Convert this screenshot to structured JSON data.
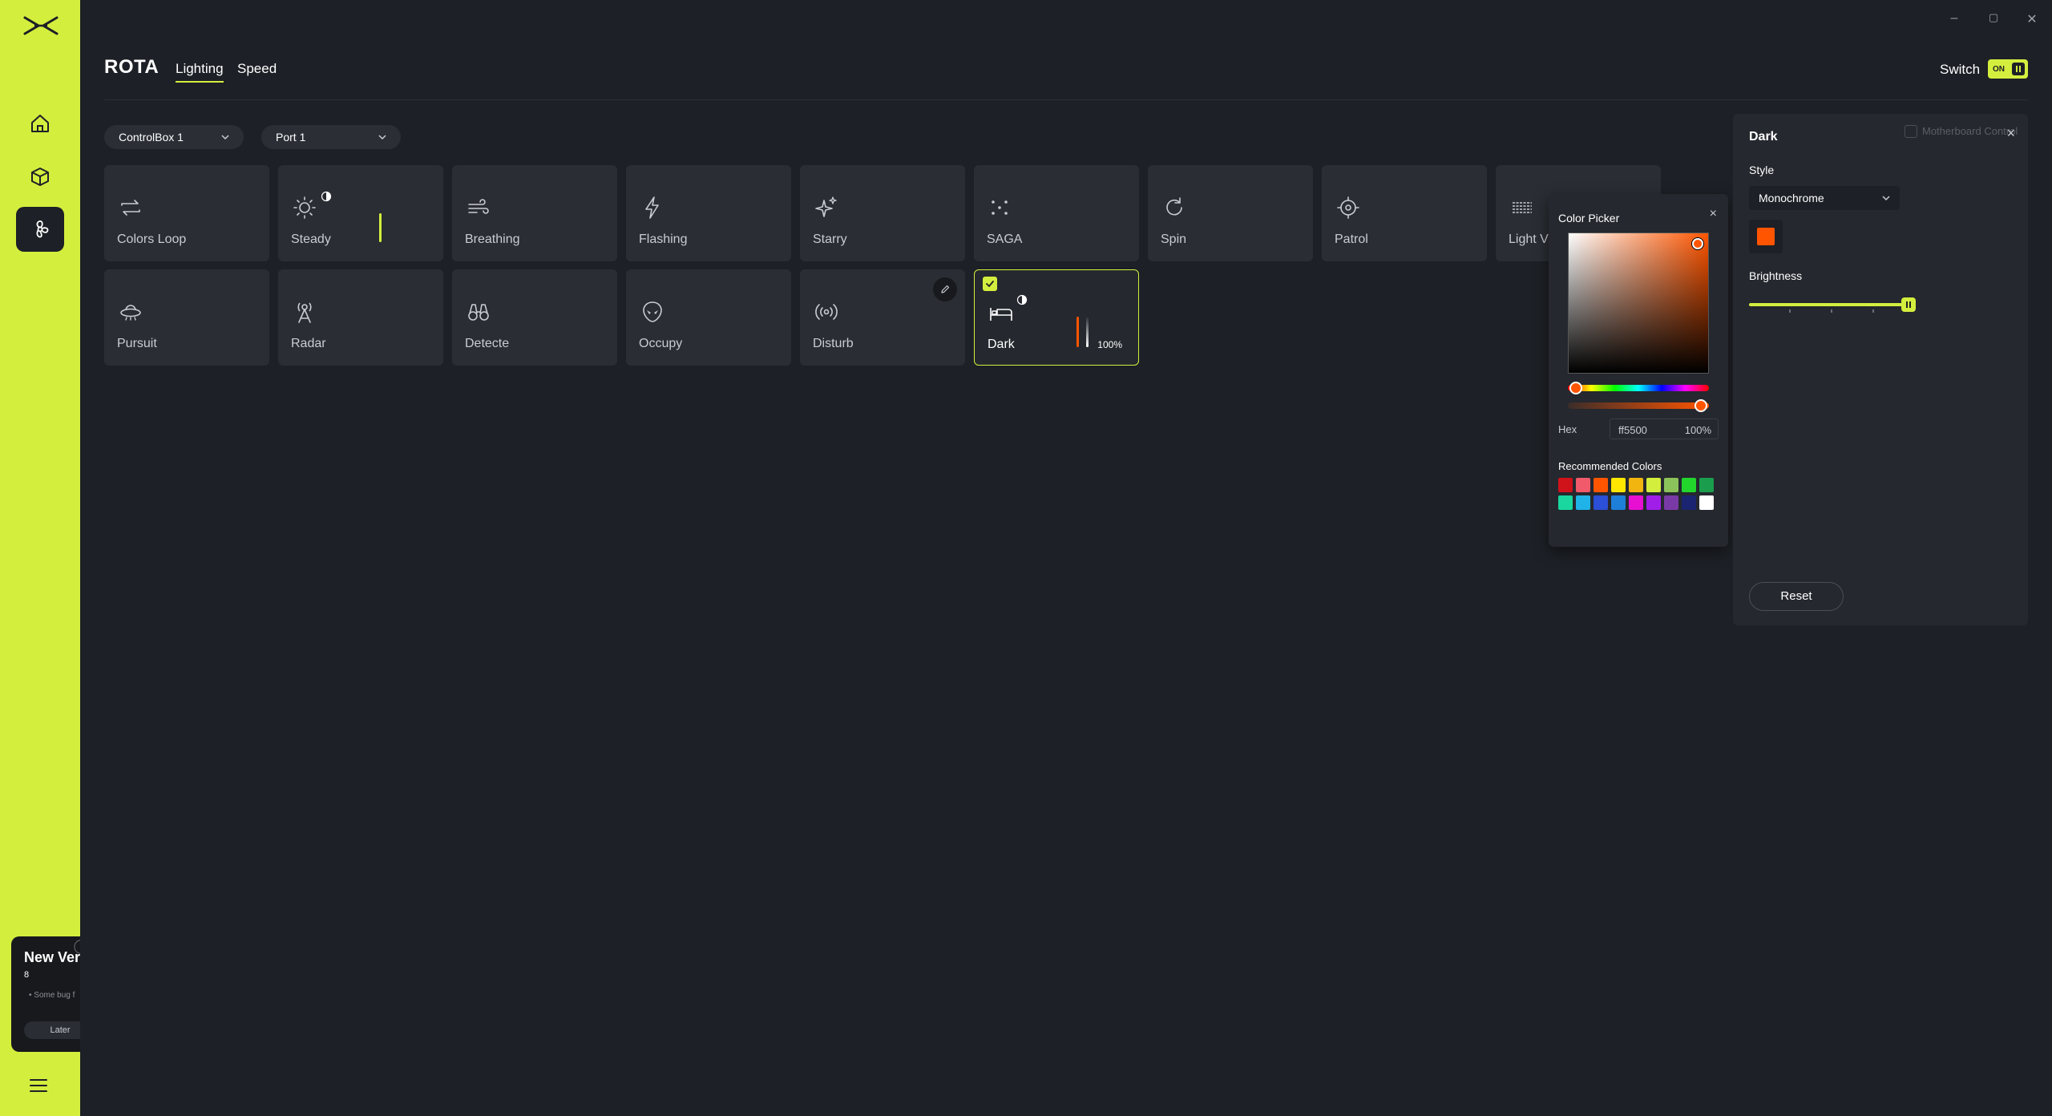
{
  "window": {
    "minimize_glyph": "–",
    "maximize_glyph": "▢",
    "close_glyph": "✕"
  },
  "sidebar": {
    "items": [
      {
        "name": "home",
        "icon": "home-icon",
        "active": false
      },
      {
        "name": "devices",
        "icon": "box-icon",
        "active": false
      },
      {
        "name": "fan",
        "icon": "fan-icon",
        "active": true
      }
    ],
    "update_card": {
      "title": "New Ver",
      "version": "8",
      "note": "• Some bug f",
      "later_label": "Later"
    }
  },
  "header": {
    "brand": "ROTA",
    "tabs": [
      {
        "label": "Lighting",
        "active": true
      },
      {
        "label": "Speed",
        "active": false
      }
    ],
    "switch_label": "Switch",
    "switch_state": "ON"
  },
  "selectors": {
    "controlbox": "ControlBox 1",
    "port": "Port 1"
  },
  "effects": [
    {
      "label": "Colors Loop",
      "icon": "loop-icon"
    },
    {
      "label": "Steady",
      "icon": "sun-icon"
    },
    {
      "label": "Breathing",
      "icon": "wind-icon"
    },
    {
      "label": "Flashing",
      "icon": "lightning-icon"
    },
    {
      "label": "Starry",
      "icon": "sparkle-icon"
    },
    {
      "label": "SAGA",
      "icon": "dots-icon"
    },
    {
      "label": "Spin",
      "icon": "rotate-icon"
    },
    {
      "label": "Patrol",
      "icon": "target-icon"
    },
    {
      "label": "Light V",
      "icon": "wave-lines-icon"
    },
    {
      "label": "Pursuit",
      "icon": "ufo-icon"
    },
    {
      "label": "Radar",
      "icon": "radar-icon"
    },
    {
      "label": "Detecte",
      "icon": "binoculars-icon"
    },
    {
      "label": "Occupy",
      "icon": "alien-icon"
    },
    {
      "label": "Disturb",
      "icon": "broadcast-icon"
    },
    {
      "label": "Dark",
      "icon": "bed-icon",
      "selected": true,
      "brightness": "100%"
    }
  ],
  "color_picker": {
    "title": "Color Picker",
    "close_glyph": "×",
    "hex_label": "Hex",
    "hex_value": "ff5500",
    "alpha_value": "100%",
    "recommended_title": "Recommended Colors",
    "swatches": [
      "#d0121b",
      "#f05a6a",
      "#ff5500",
      "#ffe600",
      "#f2b50f",
      "#d4ee3e",
      "#8cc25a",
      "#22d62c",
      "#1a9d4d",
      "#19d79f",
      "#1fb3e8",
      "#2b4fd6",
      "#1e7fd8",
      "#e60fd2",
      "#a01ee8",
      "#7a3aa6",
      "#1a2470",
      "#ffffff"
    ]
  },
  "settings_panel": {
    "title": "Dark",
    "close_glyph": "×",
    "ghost_option": "Motherboard Control",
    "style_label": "Style",
    "style_value": "Monochrome",
    "color": "#ff5500",
    "brightness_label": "Brightness",
    "brightness": 1.0,
    "reset_label": "Reset"
  },
  "colors": {
    "accent": "#d4ee3e",
    "background": "#1d2026",
    "tile": "#2a2d33",
    "selected_color": "#ff5500"
  }
}
